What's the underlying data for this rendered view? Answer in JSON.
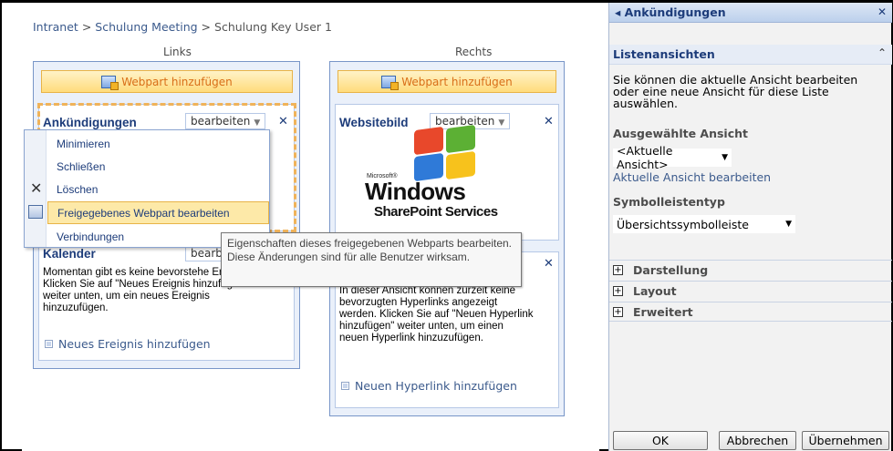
{
  "breadcrumb": {
    "site": "Intranet",
    "sep": ">",
    "page": "Schulung Meeting",
    "current": "Schulung Key User 1"
  },
  "zones": {
    "left": {
      "label": "Links",
      "add_button": "Webpart hinzufügen"
    },
    "right": {
      "label": "Rechts",
      "add_button": "Webpart hinzufügen"
    }
  },
  "webparts": {
    "announcements": {
      "title": "Ankündigungen",
      "edit": "bearbeiten",
      "close": "✕"
    },
    "calendar": {
      "title": "Kalender",
      "edit": "bearb",
      "body": "Momentan gibt es keine bevorstehe Ereignisse. Klicken Sie auf \"Neues Ereignis hinzufügen\" weiter unten, um ein neues Ereignis hinzuzufügen.",
      "link": "Neues Ereignis hinzufügen"
    },
    "site_image": {
      "title": "Websitebild",
      "edit": "bearbeiten",
      "close": "✕",
      "logo_small": "Microsoft®",
      "logo_windows": "Windows",
      "logo_sharepoint": "SharePoint Services"
    },
    "links": {
      "close": "✕",
      "body": "In dieser Ansicht können zurzeit keine bevorzugten Hyperlinks angezeigt werden. Klicken Sie auf \"Neuen Hyperlink hinzufügen\" weiter unten, um einen neuen Hyperlink hinzuzufügen.",
      "link": "Neuen Hyperlink hinzufügen"
    }
  },
  "context_menu": {
    "items": [
      {
        "label": "Minimieren"
      },
      {
        "label": "Schließen"
      },
      {
        "label": "Löschen"
      },
      {
        "label": "Freigegebenes Webpart bearbeiten"
      },
      {
        "label": "Verbindungen"
      }
    ]
  },
  "tooltip": "Eigenschaften dieses freigegebenen Webparts bearbeiten. Diese Änderungen sind für alle Benutzer wirksam.",
  "tool_pane": {
    "title": "Ankündigungen",
    "close": "✕",
    "section_title": "Listenansichten",
    "description": "Sie können die aktuelle Ansicht bearbeiten oder eine neue Ansicht für diese Liste auswählen.",
    "view_label": "Ausgewählte Ansicht",
    "view_value": "<Aktuelle Ansicht>",
    "edit_view_link": "Aktuelle Ansicht bearbeiten",
    "toolbar_label": "Symbolleistentyp",
    "toolbar_value": "Übersichtssymbolleiste",
    "expanders": [
      "Darstellung",
      "Layout",
      "Erweitert"
    ],
    "buttons": {
      "ok": "OK",
      "cancel": "Abbrechen",
      "apply": "Übernehmen"
    }
  },
  "colors": {
    "accent": "#1d3c7a",
    "link": "#3b5a8c",
    "add_button_text": "#d86e18",
    "highlight": "#fde9a8"
  }
}
